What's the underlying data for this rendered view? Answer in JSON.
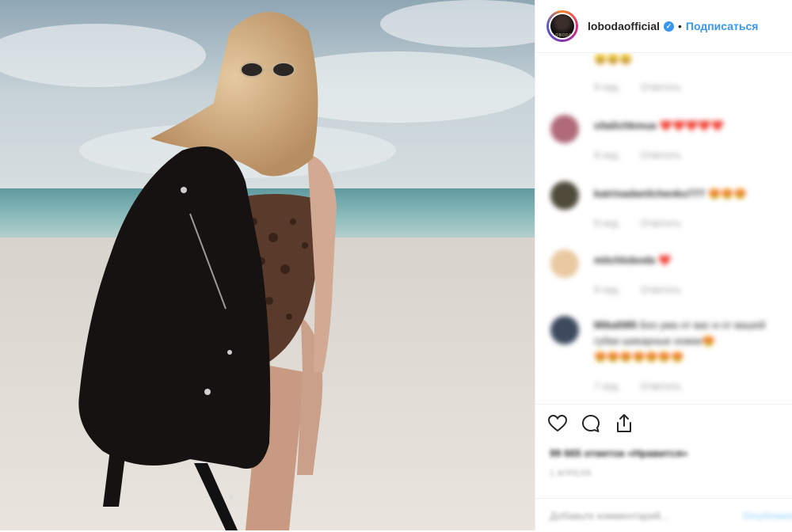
{
  "post": {
    "username": "lobodaofficial",
    "verified_mark": "✓",
    "dot": "•",
    "follow_label": "Подписаться",
    "avatar_caption": "LOBODA"
  },
  "comments": [
    {
      "user": "",
      "text": "😄😄😄",
      "time": "9 нед.",
      "reply": "Ответить",
      "avatar_color": "#ffffff"
    },
    {
      "user": "vitalichkmua",
      "text": "❤️❤️❤️❤️❤️",
      "time": "9 нед.",
      "reply": "Ответить",
      "avatar_color": "#b06a7a"
    },
    {
      "user": "katrinadanilchenko777",
      "text": "😍😍😍",
      "time": "9 нед.",
      "reply": "Ответить",
      "avatar_color": "#4f4a3a"
    },
    {
      "user": "mitchloboda",
      "text": "❤️",
      "time": "9 нед.",
      "reply": "Ответить",
      "avatar_color": "#e9c9a0"
    },
    {
      "user": "Mikal085",
      "text": "Без умa от вас и от вашей губки шикарные ножки😍",
      "text2": "😍😍😍😍😍😍😍",
      "time": "7 нед.",
      "reply": "Ответить",
      "avatar_color": "#3d4a5e"
    }
  ],
  "actions": {
    "icons": [
      "heart-icon",
      "comment-icon",
      "share-icon"
    ],
    "likes_text": "99 665 отметок «Нравится»",
    "date_text": "1 АПРЕЛЯ",
    "comment_placeholder": "Добавьте комментарий...",
    "publish_label": "Опубликовать"
  },
  "colors": {
    "accent": "#3897f0",
    "text": "#262626",
    "muted": "#999999",
    "border": "#efefef"
  }
}
